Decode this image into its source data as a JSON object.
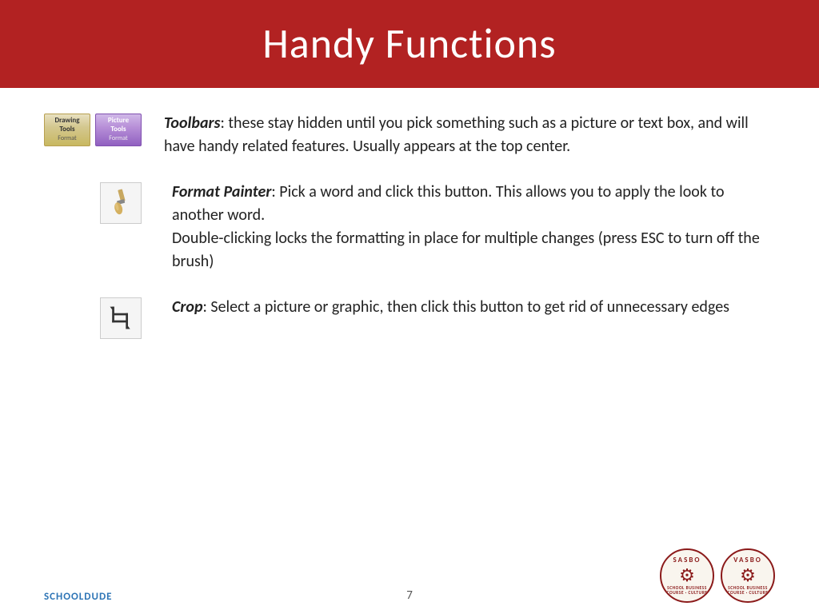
{
  "header": {
    "title": "Handy Functions",
    "bg_color": "#b22222"
  },
  "items": [
    {
      "id": "toolbars",
      "bold_label": "Toolbars",
      "text": ": these stay hidden until you pick something such as a picture or text box, and will have handy related features. Usually appears at the top center.",
      "icon_type": "toolbar-buttons"
    },
    {
      "id": "format-painter",
      "bold_label": "Format Painter",
      "text": ": Pick a word and click this button. This allows you to apply the look to another word.\nDouble-clicking locks the formatting in place for multiple changes (press ESC to turn off the brush)",
      "icon_type": "format-painter"
    },
    {
      "id": "crop",
      "bold_label": "Crop",
      "text": ": Select a picture or graphic, then click this button to get rid of unnecessary edges",
      "icon_type": "crop"
    }
  ],
  "toolbar_buttons": [
    {
      "label_top": "Drawing Tools",
      "label_bottom": "Format",
      "style": "drawing"
    },
    {
      "label_top": "Picture Tools",
      "label_bottom": "Format",
      "style": "picture"
    }
  ],
  "footer": {
    "left": "SCHOOLDUDE",
    "center": "7",
    "logos": [
      {
        "name": "SASBO",
        "wheel": "⚙"
      },
      {
        "name": "VASBO",
        "wheel": "⚙"
      }
    ]
  }
}
